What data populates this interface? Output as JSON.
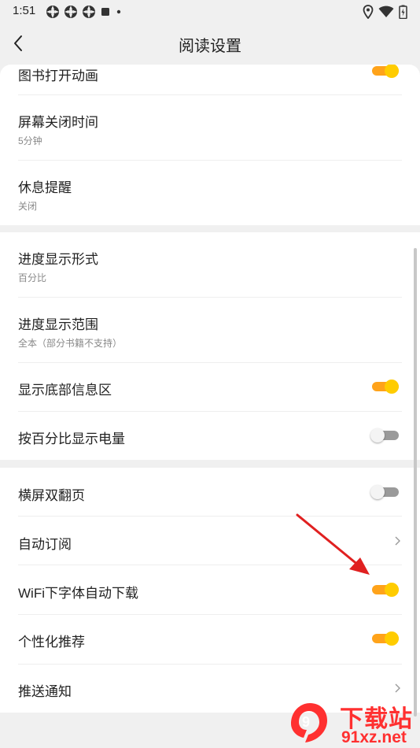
{
  "status_bar": {
    "time": "1:51"
  },
  "header": {
    "title": "阅读设置",
    "back_icon": "chevron-left-icon"
  },
  "group1": {
    "book_open_animation": {
      "title": "图书打开动画",
      "toggle_on": true
    },
    "screen_off_time": {
      "title": "屏幕关闭时间",
      "value": "5分钟"
    },
    "rest_reminder": {
      "title": "休息提醒",
      "value": "关闭"
    }
  },
  "group2": {
    "progress_format": {
      "title": "进度显示形式",
      "value": "百分比"
    },
    "progress_range": {
      "title": "进度显示范围",
      "value": "全本（部分书籍不支持）"
    },
    "show_bottom_info": {
      "title": "显示底部信息区",
      "toggle_on": true
    },
    "battery_percent": {
      "title": "按百分比显示电量",
      "toggle_on": false
    }
  },
  "group3": {
    "landscape_double_page": {
      "title": "横屏双翻页",
      "toggle_on": false
    },
    "auto_subscribe": {
      "title": "自动订阅"
    },
    "wifi_font_download": {
      "title": "WiFi下字体自动下载",
      "toggle_on": true
    },
    "personalized_recommend": {
      "title": "个性化推荐",
      "toggle_on": true
    },
    "push_notification": {
      "title": "推送通知"
    }
  },
  "watermark": {
    "logo_text": "9",
    "cn": "下载站",
    "en": "91xz.net"
  },
  "colors": {
    "accent": "#ffcc00",
    "accent_track": "#ffa31a",
    "annotation": "#e02020",
    "watermark": "#ff3030"
  }
}
